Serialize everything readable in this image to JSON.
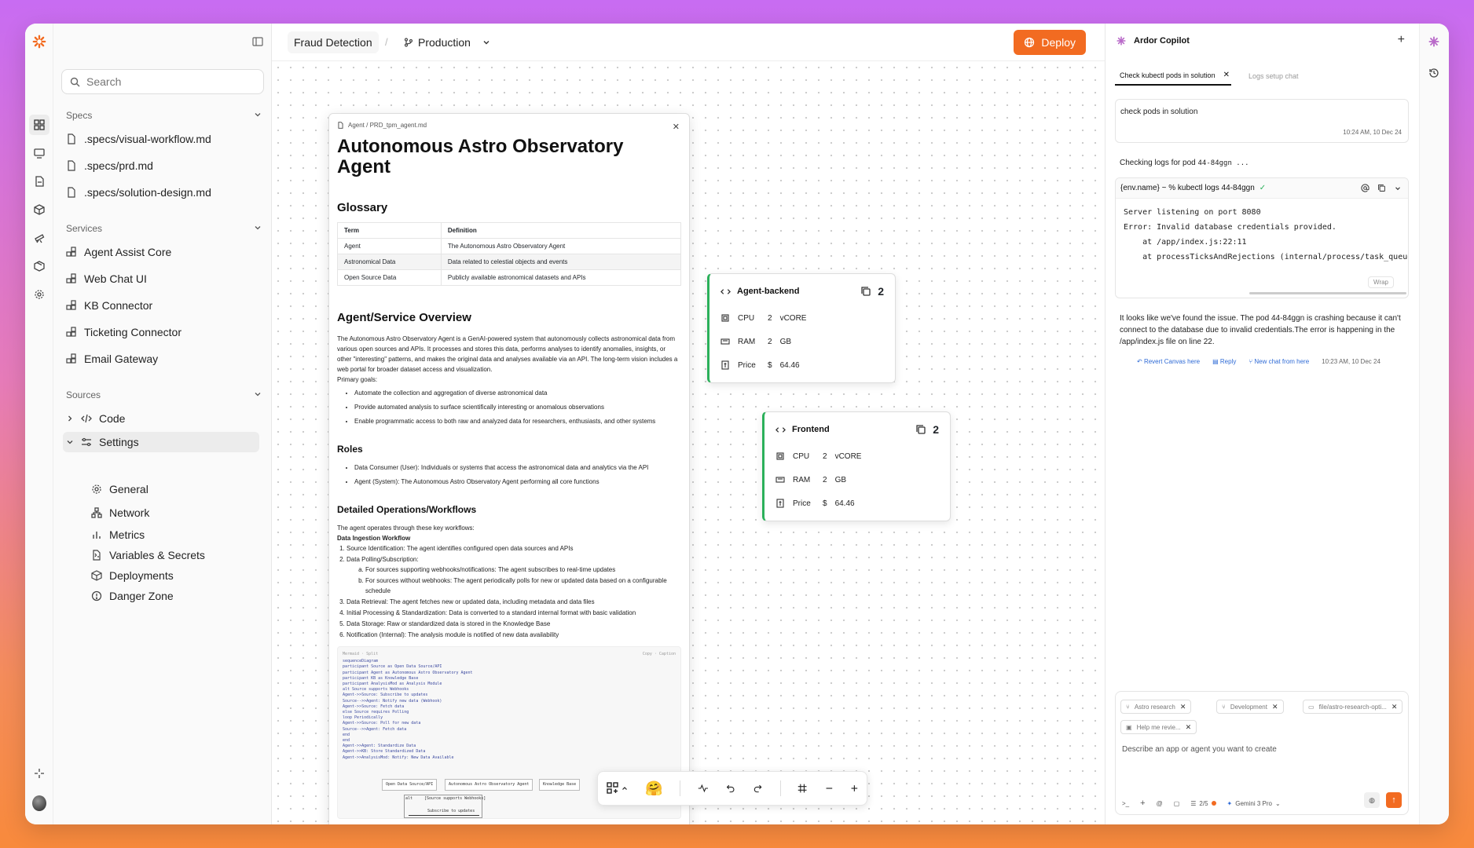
{
  "sidebar": {
    "search_placeholder": "Search",
    "specs_title": "Specs",
    "specs": [
      ".specs/visual-workflow.md",
      ".specs/prd.md",
      ".specs/solution-design.md"
    ],
    "services_title": "Services",
    "services": [
      "Agent Assist Core",
      "Web Chat UI",
      "KB Connector",
      "Ticketing Connector",
      "Email Gateway"
    ],
    "sources_title": "Sources",
    "code_label": "Code",
    "settings_label": "Settings",
    "settings_items": [
      "General",
      "Network",
      "Metrics",
      "Variables & Secrets",
      "Deployments",
      "Danger Zone"
    ]
  },
  "topbar": {
    "project": "Fraud Detection",
    "branch": "Production",
    "deploy_label": "Deploy"
  },
  "doc": {
    "path": "Agent / PRD_tpm_agent.md",
    "title": "Autonomous Astro Observatory Agent",
    "glossary_title": "Glossary",
    "glossary_headers": [
      "Term",
      "Definition"
    ],
    "glossary_rows": [
      [
        "Agent",
        "The Autonomous Astro Observatory Agent"
      ],
      [
        "Astronomical Data",
        "Data related to celestial objects and events"
      ],
      [
        "Open Source Data",
        "Publicly available astronomical datasets and APIs"
      ]
    ],
    "overview_title": "Agent/Service Overview",
    "overview_text": "The Autonomous Astro Observatory Agent is a GenAI-powered system that autonomously collects astronomical data from various open sources and APIs. It processes and stores this data, performs analyses to identify anomalies, insights, or other \"interesting\" patterns, and makes the original data and analyses available via an API. The long-term vision includes a web portal for broader dataset access and visualization.",
    "primary_goals": "Primary goals:",
    "goals": [
      "Automate the collection and aggregation of diverse astronomical data",
      "Provide automated analysis to surface scientifically interesting or anomalous observations",
      "Enable programmatic access to both raw and analyzed data for researchers, enthusiasts, and other systems"
    ],
    "roles_title": "Roles",
    "roles": [
      "Data Consumer (User): Individuals or systems that access the astronomical data and analytics via the API",
      "Agent (System): The Autonomous Astro Observatory Agent performing all core functions"
    ],
    "ops_title": "Detailed Operations/Workflows",
    "ops_intro": "The agent operates through these key workflows:",
    "ingestion_title": "Data Ingestion Workflow",
    "steps": [
      "Source Identification: The agent identifies configured open data sources and APIs",
      "Data Polling/Subscription:"
    ],
    "substeps": [
      "For sources supporting webhooks/notifications: The agent subscribes to real-time updates",
      "For sources without webhooks: The agent periodically polls for new or updated data based on a configurable schedule"
    ],
    "steps2": [
      "Data Retrieval: The agent fetches new or updated data, including metadata and data files",
      "Initial Processing & Standardization: Data is converted to a standard internal format with basic validation",
      "Data Storage: Raw or standardized data is stored in the Knowledge Base",
      "Notification (Internal): The analysis module is notified of new data availability"
    ],
    "code_header_left": "Mermaid · Split",
    "code_header_right": "Copy · Caption",
    "code_lines": [
      "sequenceDiagram",
      "participant Source as Open Data Source/API",
      "participant Agent as Autonomous Astro Observatory Agent",
      "participant KB as Knowledge Base",
      "participant AnalysisMod as Analysis Module",
      "alt Source supports Webhooks",
      "Agent->>Source: Subscribe to updates",
      "Source-->>Agent: Notify new data (Webhook)",
      "Agent->>Source: Fetch data",
      "else Source requires Polling",
      "loop Periodically",
      "Agent->>Source: Poll for new data",
      "Source-->>Agent: Fetch data",
      "end",
      "end",
      "Agent->>Agent: Standardize Data",
      "Agent->>KB: Store Standardized Data",
      "Agent->>AnalysisMod: Notify: New Data Available"
    ],
    "seq_boxes": [
      "Open Data Source/API",
      "Autonomous Astro Observatory Agent",
      "Knowledge Base"
    ],
    "seq_alt": "alt",
    "seq_note": "[Source supports Webhooks]",
    "seq_arrow": "Subscribe to updates"
  },
  "services_cards": [
    {
      "name": "Agent-backend",
      "count": "2",
      "cpu_label": "CPU",
      "cpu": "2",
      "cpu_unit": "vCORE",
      "ram_label": "RAM",
      "ram": "2",
      "ram_unit": "GB",
      "price_label": "Price",
      "price_cur": "$",
      "price": "64.46"
    },
    {
      "name": "Frontend",
      "count": "2",
      "cpu_label": "CPU",
      "cpu": "2",
      "cpu_unit": "vCORE",
      "ram_label": "RAM",
      "ram": "2",
      "ram_unit": "GB",
      "price_label": "Price",
      "price_cur": "$",
      "price": "64.46"
    }
  ],
  "copilot": {
    "title": "Ardor Copilot",
    "tabs": [
      "Check kubectl pods in solution",
      "Logs setup chat"
    ],
    "user_msg": "check pods in solution",
    "user_time": "10:24 AM, 10 Dec 24",
    "checking_prefix": "Checking logs for pod ",
    "checking_pod": "44-84ggn ...",
    "term_cmd": "{env.name} ~ % kubectl logs 44-84ggn",
    "term_output": "Server listening on port 8080\nError: Invalid database credentials provided.\n    at /app/index.js:22:11\n    at processTicksAndRejections (internal/process/task_queues",
    "wrap_label": "Wrap",
    "answer": "It looks like we've found the issue. The pod 44-84ggn is crashing because it can't connect to the database due to invalid credentials.The error is happening in the /app/index.js file on line 22.",
    "actions": [
      "Revert Canvas here",
      "Reply",
      "New chat from here"
    ],
    "answer_time": "10:23 AM, 10 Dec 24",
    "chips": [
      "Astro research",
      "Development",
      "file/astro-research-opti...",
      "Help me revie..."
    ],
    "composer_placeholder": "Describe an app or agent you want to create",
    "counter": "2/5",
    "model": "Gemini 3 Pro"
  },
  "colors": {
    "accent": "#f26b21",
    "healthy": "#2bb05a",
    "link": "#2f6bd6"
  }
}
